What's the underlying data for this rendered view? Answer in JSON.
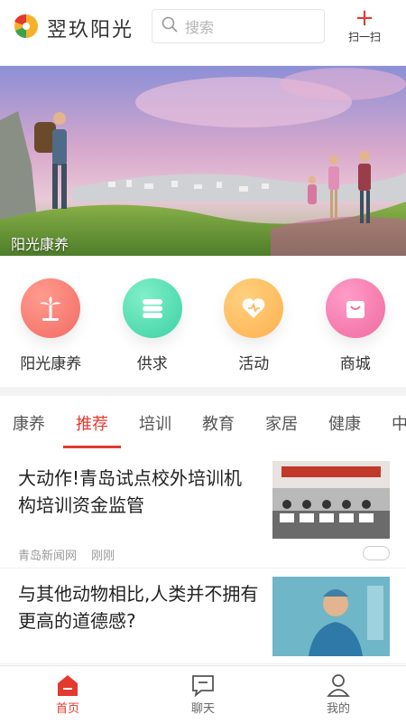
{
  "header": {
    "brand_name": "翌玖阳光",
    "search_placeholder": "搜索",
    "scan_label": "扫一扫"
  },
  "banner": {
    "caption": "阳光康养"
  },
  "categories": [
    {
      "label": "阳光康养",
      "color": "#f26b63",
      "icon": "palm-tree-icon"
    },
    {
      "label": "供求",
      "color": "#3ed0a4",
      "icon": "stack-icon"
    },
    {
      "label": "活动",
      "color": "#ffb14e",
      "icon": "heart-icon"
    },
    {
      "label": "商城",
      "color": "#f06aa0",
      "icon": "shopping-bag-icon"
    }
  ],
  "tabs": [
    {
      "label": "康养",
      "active": false
    },
    {
      "label": "推荐",
      "active": true
    },
    {
      "label": "培训",
      "active": false
    },
    {
      "label": "教育",
      "active": false
    },
    {
      "label": "家居",
      "active": false
    },
    {
      "label": "健康",
      "active": false
    },
    {
      "label": "中",
      "active": false
    }
  ],
  "articles": [
    {
      "title": "大动作!青岛试点校外培训机构培训资金监管",
      "source": "青岛新闻网",
      "time": "刚刚"
    },
    {
      "title": "与其他动物相比,人类并不拥有更高的道德感?"
    }
  ],
  "bottom_nav": [
    {
      "label": "首页",
      "icon": "home-icon",
      "active": true
    },
    {
      "label": "聊天",
      "icon": "chat-icon",
      "active": false
    },
    {
      "label": "我的",
      "icon": "user-icon",
      "active": false
    }
  ],
  "colors": {
    "accent": "#e23a2f"
  }
}
